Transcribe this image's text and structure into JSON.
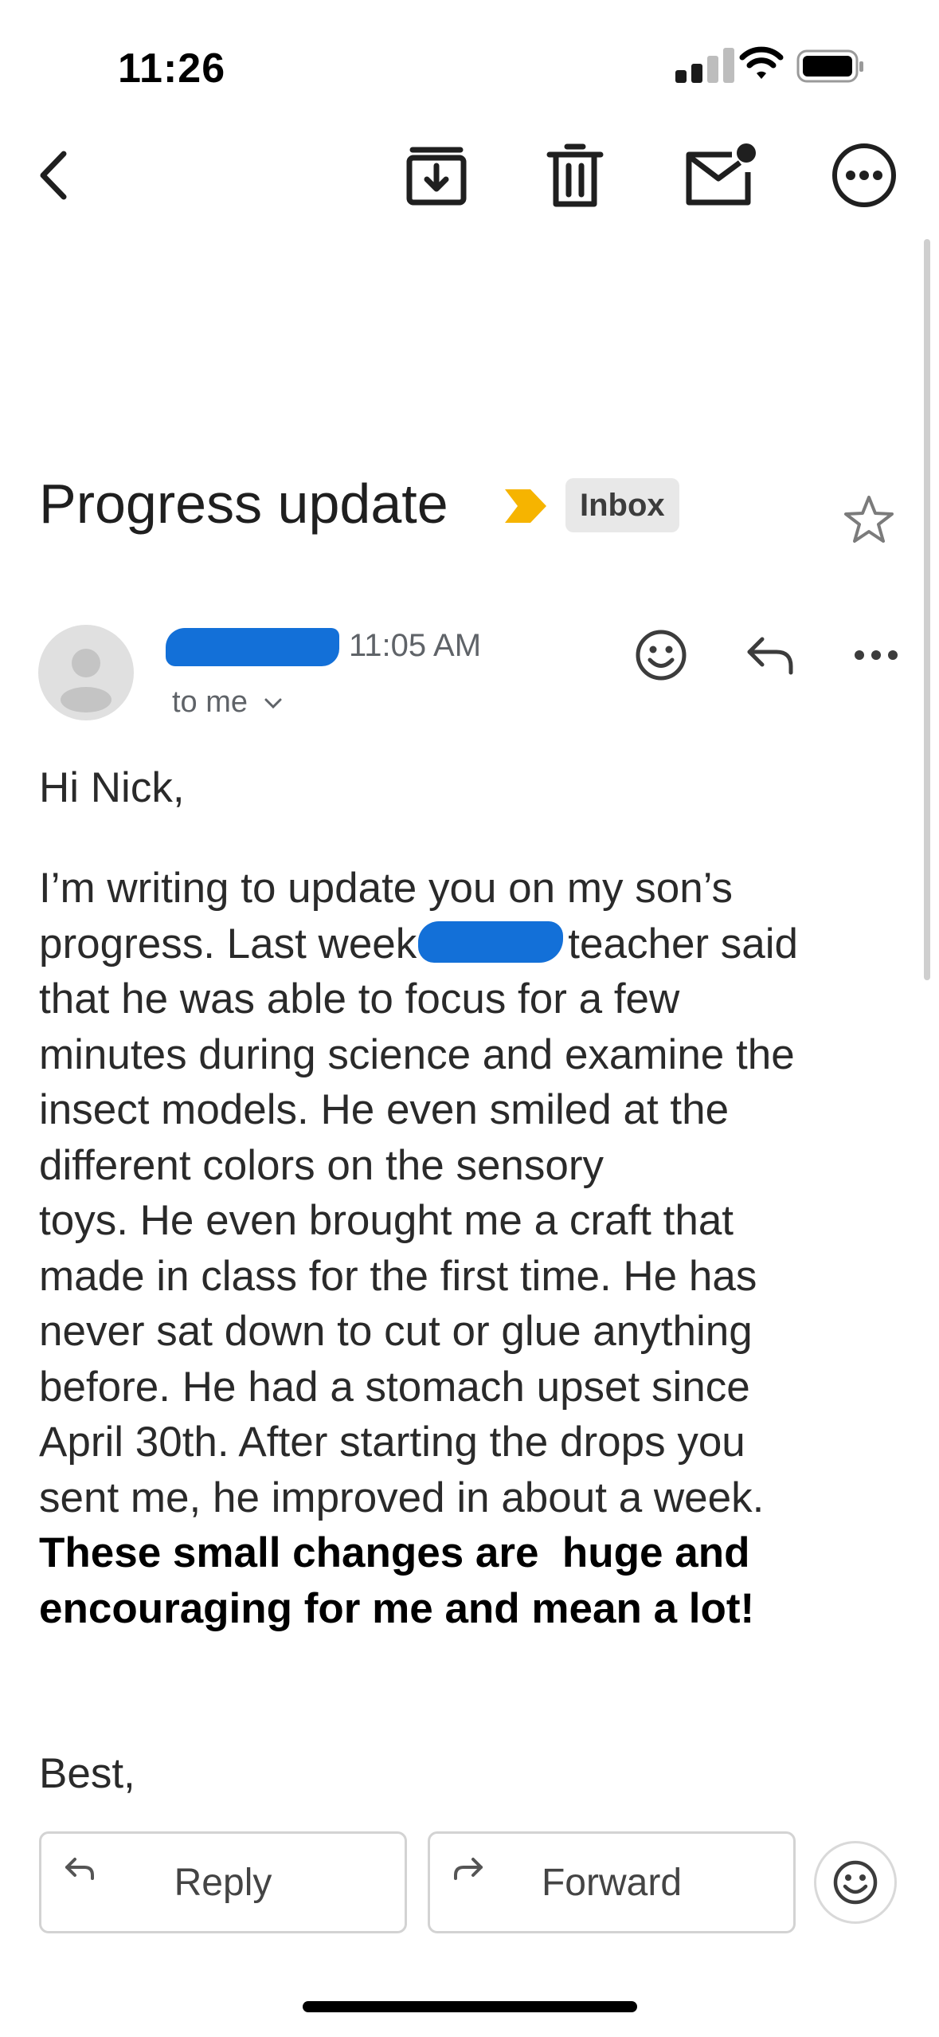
{
  "status_bar": {
    "time": "11:26"
  },
  "toolbar": {
    "back": "back-icon",
    "archive": "archive-icon",
    "delete": "trash-icon",
    "mark_unread": "mail-unread-icon",
    "more": "more-options-icon"
  },
  "email": {
    "subject": "Progress update",
    "label": "Inbox",
    "sent_time": "11:05 AM",
    "to": "to me",
    "greeting": "Hi Nick,",
    "body_lines": [
      "I’m writing to update you on my son’s",
      "progress. Last week",
      "teacher said",
      "that he was able to focus for a few",
      "minutes during science and examine the",
      "insect models. He even smiled at the",
      "different colors on the sensory",
      "toys. He even brought me a craft that",
      "made in class for the first time. He has",
      "never sat down to cut or glue anything",
      "before. He had a stomach upset since",
      "April 30th. After starting the drops you",
      "sent me, he improved in about a week.",
      "These small changes are  huge and",
      "encouraging for me and mean a lot!"
    ],
    "signoff": "Best,"
  },
  "actions": {
    "reply": "Reply",
    "forward": "Forward"
  },
  "colors": {
    "redaction": "#1370d8",
    "important_marker": "#f6b400"
  }
}
